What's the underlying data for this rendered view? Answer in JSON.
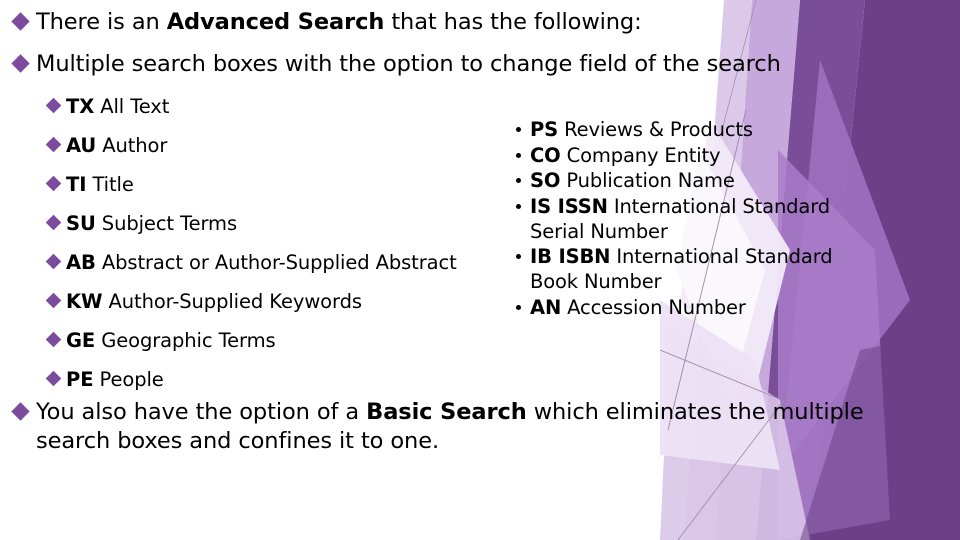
{
  "slide": {
    "background_color": "#ffffff",
    "bullet_color": "#7C4B9E",
    "accent_colors": {
      "dark_purple": "#6B4089",
      "mid_purple": "#8256A5",
      "purple": "#9B6FBE",
      "light_purple": "#C6A8DC",
      "pale_lavender": "#DCC9EA",
      "very_pale": "#EFE6F6",
      "near_white": "#F8F4FB",
      "hairline": "#9A8AA8"
    }
  },
  "intro": {
    "line1_prefix": "There is an ",
    "line1_bold": "Advanced Search",
    "line1_suffix": " that has the following:",
    "line2": "Multiple search boxes with the option to change field of the search"
  },
  "left_column": [
    {
      "code": "TX",
      "label": " All Text"
    },
    {
      "code": "AU",
      "label": " Author"
    },
    {
      "code": "TI",
      "label": " Title"
    },
    {
      "code": "SU",
      "label": " Subject Terms"
    },
    {
      "code": "AB",
      "label": " Abstract or Author-Supplied Abstract"
    },
    {
      "code": "KW",
      "label": " Author-Supplied Keywords"
    },
    {
      "code": "GE",
      "label": " Geographic Terms"
    },
    {
      "code": "PE",
      "label": " People"
    }
  ],
  "right_column": [
    {
      "code": "PS",
      "label": " Reviews & Products"
    },
    {
      "code": "CO",
      "label": " Company Entity"
    },
    {
      "code": "SO",
      "label": " Publication Name"
    },
    {
      "code": "IS ISSN",
      "label": " International Standard Serial Number"
    },
    {
      "code": "IB ISBN",
      "label": " International Standard Book Number"
    },
    {
      "code": "AN",
      "label": " Accession Number"
    }
  ],
  "outro": {
    "prefix": "You also have the option of a ",
    "bold": "Basic Search",
    "suffix": " which eliminates the multiple search boxes and confines it to one."
  }
}
